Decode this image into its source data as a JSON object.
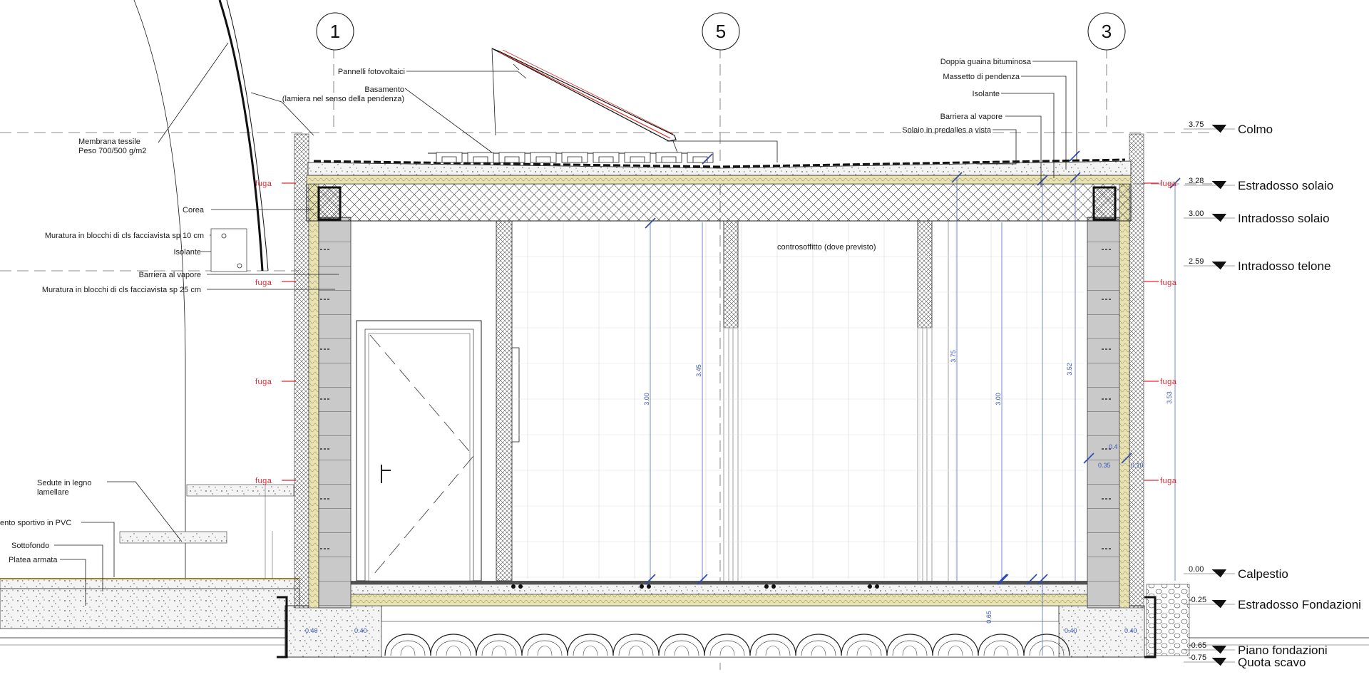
{
  "axes": [
    "1",
    "5",
    "3"
  ],
  "levels": [
    {
      "value": "3.75",
      "label": "Colmo"
    },
    {
      "value": "3.28",
      "label": "Estradosso solaio"
    },
    {
      "value": "3.00",
      "label": "Intradosso solaio"
    },
    {
      "value": "2.59",
      "label": "Intradosso telone"
    },
    {
      "value": "0.00",
      "label": "Calpestio"
    },
    {
      "value": "-0.25",
      "label": "Estradosso Fondazioni"
    },
    {
      "value": "-0.65",
      "label": "Piano fondazioni"
    },
    {
      "value": "-0.75",
      "label": "Quota scavo"
    }
  ],
  "annotations": {
    "pannelli": "Pannelli fotovoltaici",
    "basamento": "Basamento",
    "basamento_note": "(lamiera nel senso della pendenza)",
    "membrana_1": "Membrana tessile",
    "membrana_2": "Peso 700/500 g/m2",
    "corea": "Corea",
    "muratura_10": "Muratura in blocchi di cls facciavista sp 10 cm",
    "isolante_left": "Isolante",
    "barriera_left": "Barriera al vapore",
    "muratura_25": "Muratura in blocchi di cls facciavista sp 25 cm",
    "sedute_1": "Sedute in legno",
    "sedute_2": "lamellare",
    "pavimento": "ento sportivo in PVC",
    "sottofondo": "Sottofondo",
    "platea": "Platea armata",
    "doppia_guaina": "Doppia guaina bituminosa",
    "massetto": "Massetto di pendenza",
    "isolante_right": "Isolante",
    "barriera_right": "Barriera al vapore",
    "solaio": "Solaio in predalles a vista",
    "controsoffitto": "controsoffitto (dove previsto)",
    "fuga": "fuga"
  },
  "dimensions": [
    "3.00",
    "3.45",
    "3.75",
    "3.00",
    "3.52",
    "3.53",
    "0.65",
    "0.40",
    "0.40",
    "0.40",
    "0.40",
    "0.35",
    "0.10",
    "0.4"
  ],
  "colors": {
    "line": "#1a1a1a",
    "fuga": "#e8262d",
    "dimension": "#3a56b8",
    "insulation": "#e9e3b4",
    "block": "#c8c8c8",
    "photovoltaic": "#d9302a"
  }
}
